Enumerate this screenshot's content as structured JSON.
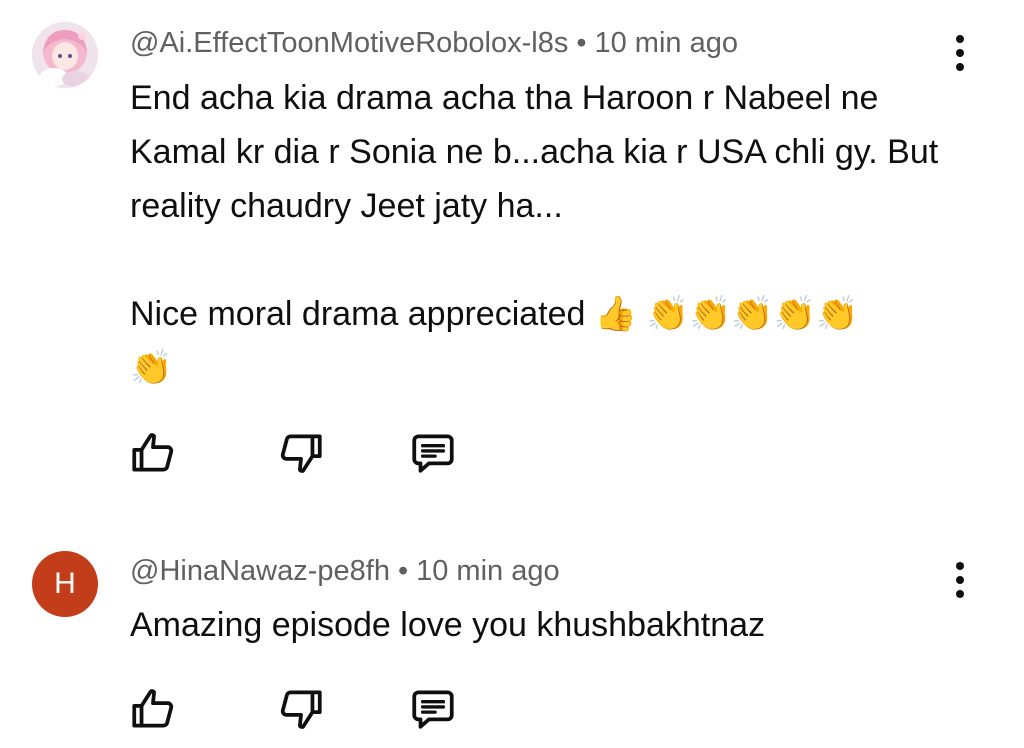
{
  "comments": [
    {
      "author": "@Ai.EffectToonMotiveRobolox-l8s",
      "separator": "•",
      "time": "10 min ago",
      "text": "End acha kia drama acha tha Haroon r Nabeel ne Kamal kr dia r Sonia ne b...acha kia r USA chli gy. But reality chaudry Jeet jaty ha...\n\nNice moral drama appreciated 👍 👏👏👏👏👏\n👏",
      "avatar_type": "image"
    },
    {
      "author": "@HinaNawaz-pe8fh",
      "separator": "•",
      "time": "10 min ago",
      "text": "Amazing episode love you khushbakhtnaz",
      "avatar_letter": "H",
      "avatar_color": "#c43d1a"
    }
  ],
  "icons": {
    "like": "thumb-up-icon",
    "dislike": "thumb-down-icon",
    "reply": "reply-comment-icon",
    "more": "more-vertical-icon"
  }
}
